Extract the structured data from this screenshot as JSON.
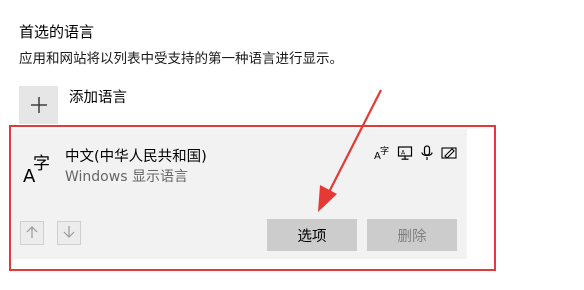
{
  "section": {
    "title": "首选的语言",
    "description": "应用和网站将以列表中受支持的第一种语言进行显示。"
  },
  "add_language": {
    "label": "添加语言",
    "icon": "plus-icon"
  },
  "language_item": {
    "name": "中文(中华人民共和国)",
    "subtitle": "Windows 显示语言",
    "icon": "language-a-zi-icon",
    "icon_glyph_a": "A",
    "icon_glyph_zi": "字",
    "features": [
      "text-to-speech-icon",
      "display-language-icon",
      "speech-recognition-icon",
      "handwriting-icon"
    ]
  },
  "buttons": {
    "options": "选项",
    "delete": "删除",
    "move_up": "up-arrow-icon",
    "move_down": "down-arrow-icon"
  },
  "colors": {
    "annotation": "#e53935",
    "card_bg": "#f2f2f2",
    "button_bg": "#cccccc",
    "disabled_text": "#7f7f7f"
  }
}
